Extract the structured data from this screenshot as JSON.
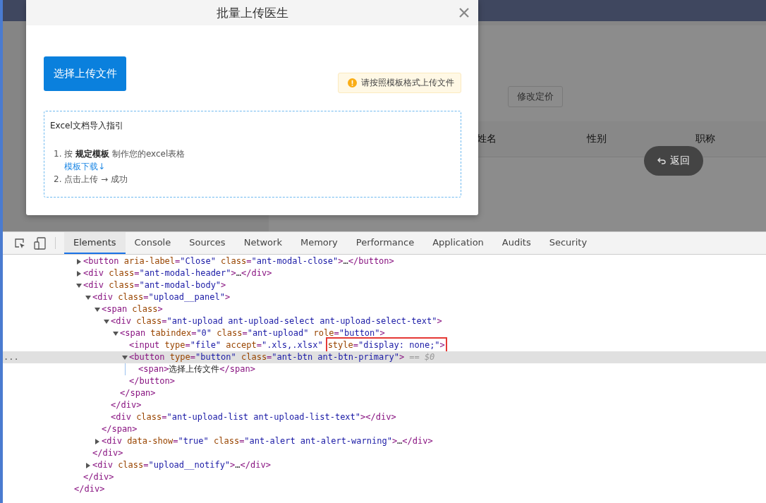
{
  "app": {
    "toolbar_buttons": [
      "修改定价"
    ],
    "table_columns": [
      "姓名",
      "性别",
      "职称"
    ],
    "back_button": {
      "label": "返回"
    }
  },
  "modal": {
    "title": "批量上传医生",
    "upload_button": "选择上传文件",
    "alert": "请按照模板格式上传文件",
    "guide": {
      "title": "Excel文档导入指引",
      "steps": [
        {
          "text": "1. 按 **规定模板** 制作您的excel表格",
          "link": "模板下载↓"
        },
        {
          "text": "2. 点击上传 → 成功"
        }
      ]
    }
  },
  "devtools": {
    "tabs": [
      {
        "label": "Elements",
        "selected": true
      },
      {
        "label": "Console",
        "selected": false
      },
      {
        "label": "Sources",
        "selected": false
      },
      {
        "label": "Network",
        "selected": false
      },
      {
        "label": "Memory",
        "selected": false
      },
      {
        "label": "Performance",
        "selected": false
      },
      {
        "label": "Application",
        "selected": false
      },
      {
        "label": "Audits",
        "selected": false
      },
      {
        "label": "Security",
        "selected": false
      }
    ],
    "dom": {
      "nodes": [
        {
          "text": "<button aria-label=\"Close\" class=\"ant-modal-close\">…</button>",
          "expanded": false,
          "selected": false
        },
        {
          "text": "<div class=\"ant-modal-header\">…</div>",
          "expanded": false,
          "selected": false
        },
        {
          "text": "<div class=\"ant-modal-body\">",
          "expanded": true,
          "selected": false,
          "closing": "</div>",
          "children": [
            {
              "text": "<div class=\"upload__panel\">",
              "expanded": true,
              "selected": false,
              "closing": "</div>",
              "children": [
                {
                  "text": "<span class>",
                  "expanded": true,
                  "selected": false,
                  "closing": "</span>",
                  "children": [
                    {
                      "text": "<div class=\"ant-upload ant-upload-select ant-upload-select-text\">",
                      "expanded": true,
                      "selected": false,
                      "closing": "</div>",
                      "children": [
                        {
                          "text": "<span tabindex=\"0\" class=\"ant-upload\" role=\"button\">",
                          "expanded": true,
                          "selected": false,
                          "closing": "</span>",
                          "children": [
                            {
                              "text": "<input type=\"file\" accept=\".xls,.xlsx\"",
                              "boxed": "style=\"display: none;\">",
                              "selected": false
                            },
                            {
                              "text": "<button type=\"button\" class=\"ant-btn ant-btn-primary\">",
                              "expanded": true,
                              "selected": true,
                              "note": "== $0",
                              "gutter": "...",
                              "closing": "</button>",
                              "children": [
                                {
                                  "text": "<span>选择上传文件</span>",
                                  "selected": false
                                }
                              ]
                            }
                          ]
                        }
                      ]
                    },
                    {
                      "text": "<div class=\"ant-upload-list ant-upload-list-text\"></div>",
                      "selected": false
                    }
                  ]
                },
                {
                  "text": "<div data-show=\"true\" class=\"ant-alert ant-alert-warning\">…</div>",
                  "expanded": false,
                  "selected": false
                }
              ]
            },
            {
              "text": "<div class=\"upload__notify\">…</div>",
              "expanded": false,
              "selected": false
            }
          ]
        }
      ],
      "closing": "</div>"
    }
  }
}
